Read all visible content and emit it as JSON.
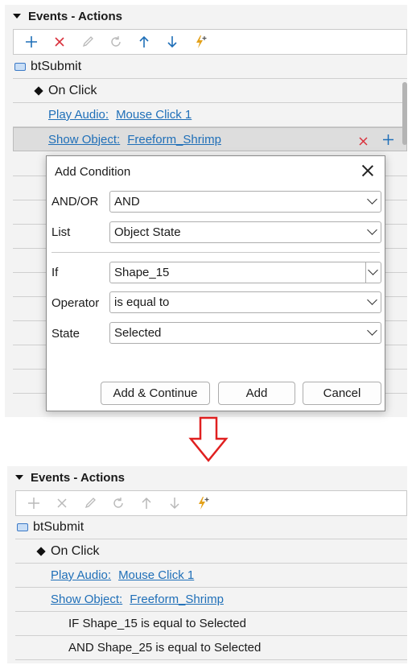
{
  "panel_header": "Events - Actions",
  "top": {
    "object_name": "btSubmit",
    "event": "On Click",
    "actions": [
      {
        "verb": "Play Audio:",
        "target": "Mouse Click 1"
      },
      {
        "verb": "Show Object:",
        "target": "Freeform_Shrimp"
      }
    ]
  },
  "dialog": {
    "title": "Add Condition",
    "andor_label": "AND/OR",
    "andor_value": "AND",
    "list_label": "List",
    "list_value": "Object State",
    "if_label": "If",
    "if_value": "Shape_15",
    "operator_label": "Operator",
    "operator_value": "is equal to",
    "state_label": "State",
    "state_value": "Selected",
    "btn_add_continue": "Add & Continue",
    "btn_add": "Add",
    "btn_cancel": "Cancel"
  },
  "bottom": {
    "object_name": "btSubmit",
    "event": "On Click",
    "actions": [
      {
        "verb": "Play Audio:",
        "target": "Mouse Click 1"
      },
      {
        "verb": "Show Object:",
        "target": "Freeform_Shrimp"
      }
    ],
    "conditions": [
      "IF Shape_15 is equal to Selected",
      "AND Shape_25 is equal to Selected"
    ]
  },
  "colors": {
    "accent_blue": "#1f6fb8",
    "delete_red": "#d9303b",
    "lightning": "#e3a11a",
    "arrow_red": "#e02020"
  }
}
